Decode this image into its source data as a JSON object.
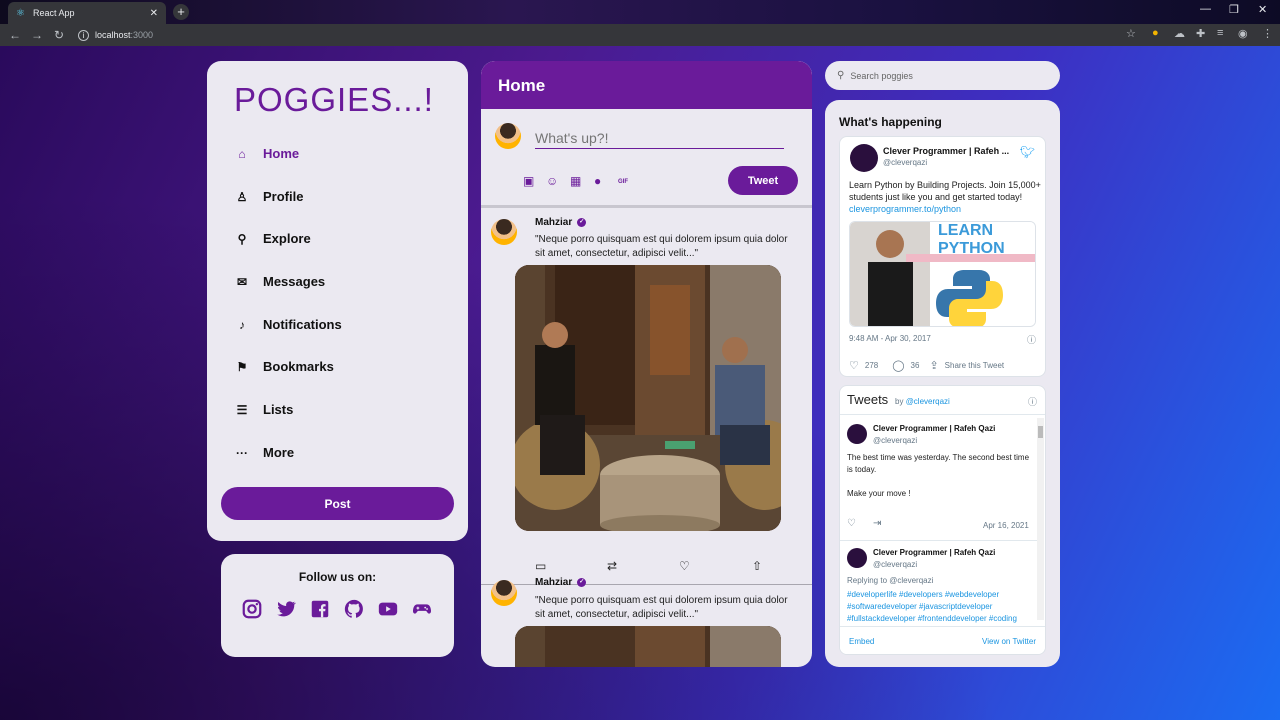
{
  "browser": {
    "tab_title": "React App",
    "url_host": "localhost",
    "url_port": ":3000"
  },
  "sidebar": {
    "logo": "POGGIES...!",
    "items": [
      {
        "label": "Home",
        "icon": "home-icon"
      },
      {
        "label": "Profile",
        "icon": "profile-icon"
      },
      {
        "label": "Explore",
        "icon": "search-icon"
      },
      {
        "label": "Messages",
        "icon": "mail-icon"
      },
      {
        "label": "Notifications",
        "icon": "bell-icon"
      },
      {
        "label": "Bookmarks",
        "icon": "bookmark-icon"
      },
      {
        "label": "Lists",
        "icon": "list-icon"
      },
      {
        "label": "More",
        "icon": "more-icon"
      }
    ],
    "post_label": "Post"
  },
  "follow": {
    "title": "Follow us on:",
    "icons": [
      "instagram-icon",
      "twitter-icon",
      "facebook-icon",
      "github-icon",
      "youtube-icon",
      "gamepad-icon"
    ]
  },
  "feed": {
    "title": "Home",
    "compose_placeholder": "What's up?!",
    "tweet_label": "Tweet",
    "gif_label": "GIF",
    "posts": [
      {
        "user": "Mahziar",
        "text": "\"Neque porro quisquam est qui dolorem ipsum quia dolor sit amet, consectetur, adipisci velit...\""
      },
      {
        "user": "Mahziar",
        "text": "\"Neque porro quisquam est qui dolorem ipsum quia dolor sit amet, consectetur, adipisci velit...\""
      }
    ]
  },
  "right": {
    "search_placeholder": "Search poggies",
    "happening_title": "What's happening",
    "embed": {
      "name": "Clever Programmer | Rafeh ...",
      "handle": "@cleverqazi",
      "text": "Learn Python by Building Projects. Join 15,000+ students just like you and get started today!",
      "link": "cleverprogrammer.to/python",
      "image_title": "LEARN PYTHON",
      "date": "9:48 AM - Apr 30, 2017",
      "likes": "278",
      "replies": "36",
      "share": "Share this Tweet"
    },
    "timeline": {
      "title": "Tweets",
      "by": "by",
      "by_handle": "@cleverqazi",
      "items": [
        {
          "name": "Clever Programmer | Rafeh Qazi",
          "handle": "@cleverqazi",
          "text": "The best time was yesterday. The second best time is today.",
          "text2": "Make your move !",
          "date": "Apr 16, 2021"
        },
        {
          "name": "Clever Programmer | Rafeh Qazi",
          "handle": "@cleverqazi",
          "reply": "Replying to @cleverqazi",
          "tags": "#developerlife #developers #webdeveloper #softwaredeveloper #javascriptdeveloper #fullstackdeveloper #frontenddeveloper #coding"
        }
      ],
      "embed_label": "Embed",
      "view_label": "View on Twitter"
    }
  },
  "colors": {
    "accent": "#6a1b9a",
    "link": "#1b95e0"
  }
}
